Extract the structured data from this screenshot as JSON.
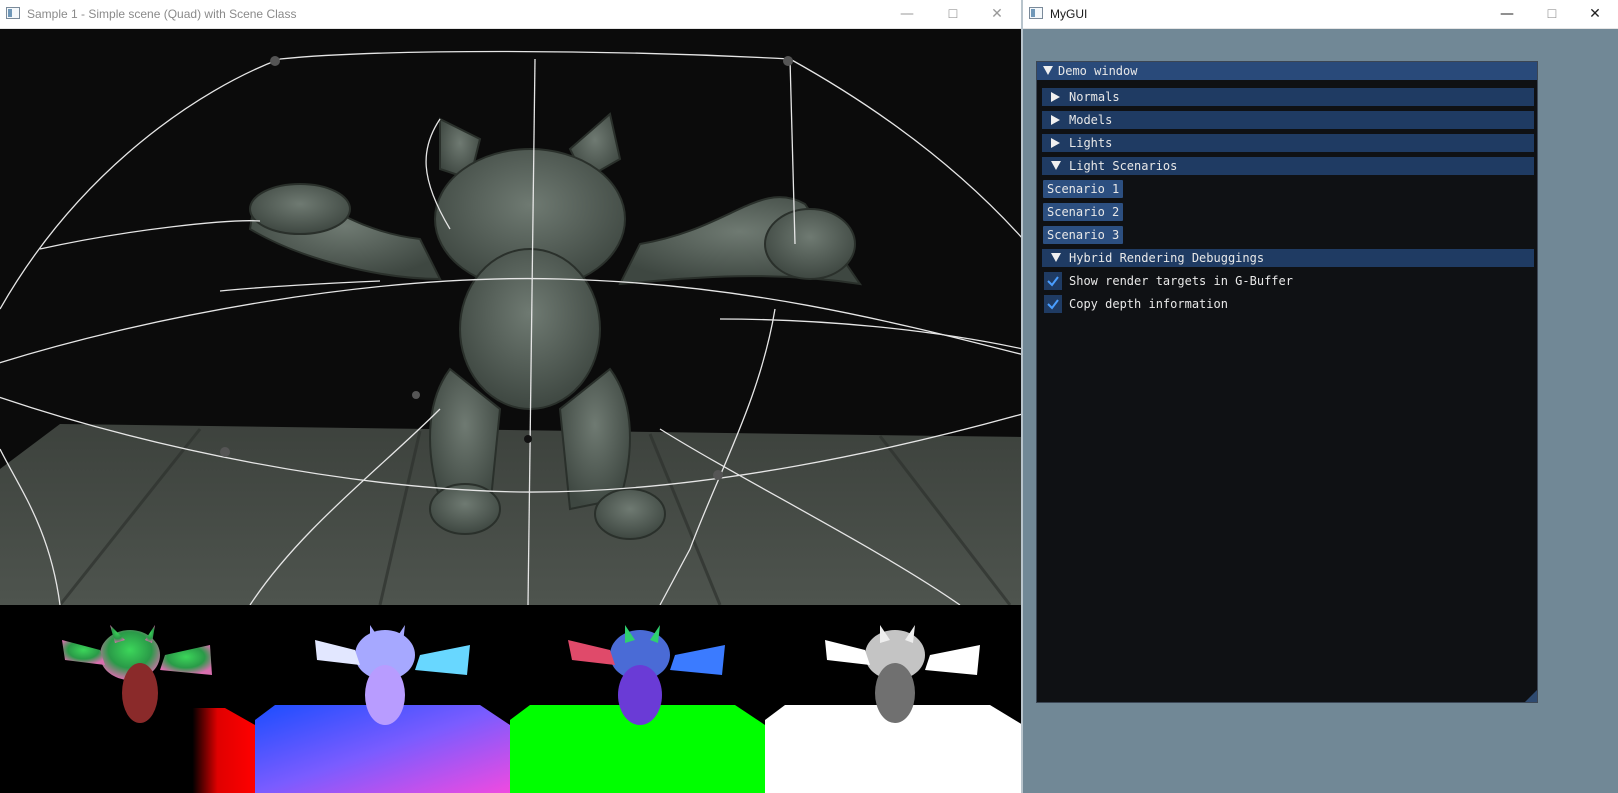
{
  "left_window": {
    "title": "Sample 1 - Simple scene (Quad) with Scene Class",
    "controls": {
      "minimize": "—",
      "maximize": "☐",
      "close": "✕"
    }
  },
  "right_window": {
    "title": "MyGUI",
    "controls": {
      "minimize": "—",
      "maximize": "☐",
      "close": "✕"
    }
  },
  "demo_window": {
    "title": "Demo window",
    "sections": [
      {
        "label": "Normals",
        "expanded": false
      },
      {
        "label": "Models",
        "expanded": false
      },
      {
        "label": "Lights",
        "expanded": false
      },
      {
        "label": "Light Scenarios",
        "expanded": true
      },
      {
        "label": "Hybrid Rendering Debuggings",
        "expanded": true
      }
    ],
    "scenario_buttons": [
      "Scenario 1",
      "Scenario 2",
      "Scenario 3"
    ],
    "checkboxes": [
      {
        "label": "Show render targets in G-Buffer",
        "checked": true
      },
      {
        "label": "Copy depth information",
        "checked": true
      }
    ]
  },
  "colors": {
    "gui_background": "#718896",
    "demo_bg": "#0f1114",
    "header": "#1f3b63",
    "title_active": "#294a7a",
    "button": "#2c4f80"
  }
}
